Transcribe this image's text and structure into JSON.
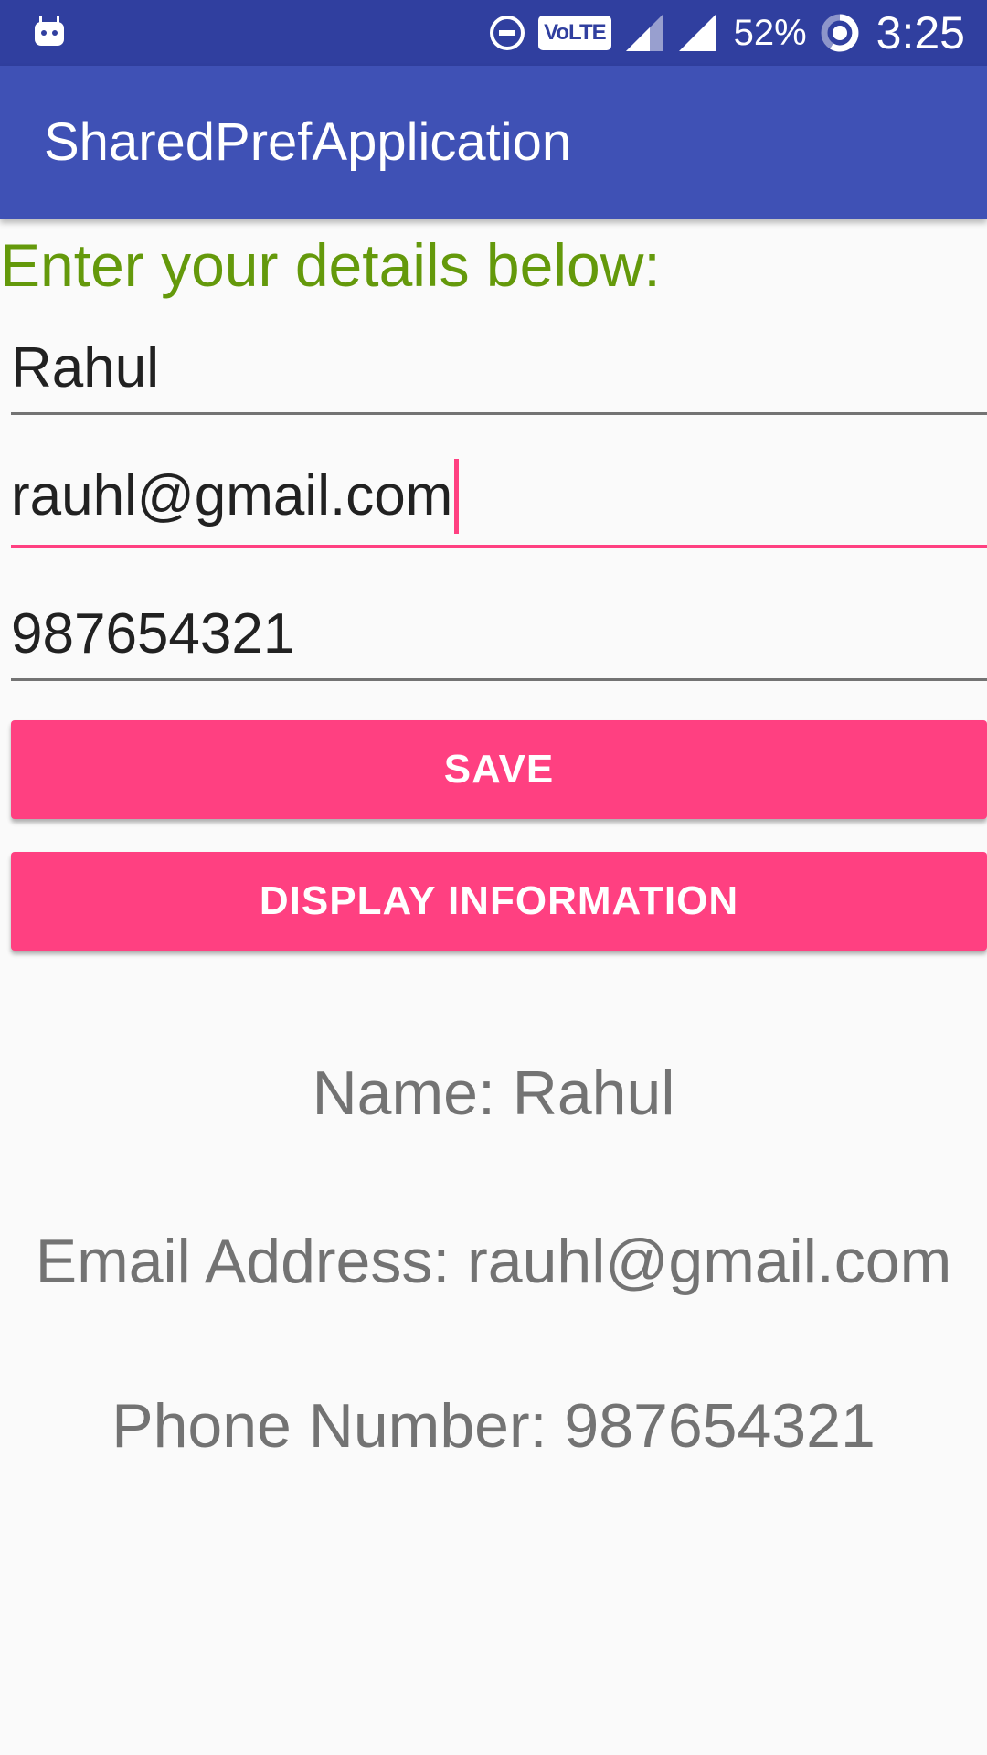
{
  "status_bar": {
    "notification_icon": "android-icon",
    "dnd_icon": "do-not-disturb-icon",
    "volte_label": "VoLTE",
    "signal_icons": [
      "signal-icon",
      "signal-icon"
    ],
    "battery_percent": "52%",
    "battery_icon": "battery-ring-icon",
    "time": "3:25"
  },
  "app_bar": {
    "title": "SharedPrefApplication",
    "color": "#3f51b5"
  },
  "form": {
    "intro": "Enter your details below:",
    "name_value": "Rahul",
    "email_value": "rauhl@gmail.com",
    "phone_value": "987654321",
    "save_label": "SAVE",
    "display_label": "DISPLAY INFORMATION",
    "accent_color": "#ff4081",
    "intro_color": "#64990b"
  },
  "info": {
    "name_line": "Name: Rahul",
    "email_line": "Email Address: rauhl@gmail.com",
    "phone_line": "Phone Number: 987654321"
  }
}
